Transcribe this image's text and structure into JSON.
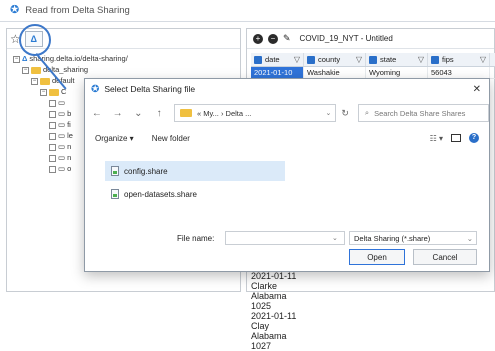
{
  "window": {
    "title": "Read from Delta Sharing"
  },
  "left": {
    "tree": [
      {
        "text": "sharing.delta.io/delta-sharing/",
        "level": 0,
        "kind": "server"
      },
      {
        "text": "delta_sharing",
        "level": 1,
        "kind": "folder"
      },
      {
        "text": "default",
        "level": 2,
        "kind": "folder"
      },
      {
        "text": "C",
        "level": 3,
        "kind": "table"
      },
      {
        "text": "",
        "level": 4,
        "kind": "item"
      },
      {
        "text": "b",
        "level": 4,
        "kind": "item"
      },
      {
        "text": "fi",
        "level": 4,
        "kind": "item"
      },
      {
        "text": "le",
        "level": 4,
        "kind": "item"
      },
      {
        "text": "n",
        "level": 4,
        "kind": "item"
      },
      {
        "text": "n",
        "level": 4,
        "kind": "item"
      },
      {
        "text": "o",
        "level": 4,
        "kind": "item"
      }
    ]
  },
  "right": {
    "title": "COVID_19_NYT - Untitled",
    "columns": [
      "date",
      "county",
      "state",
      "fips"
    ],
    "rows": [
      [
        "2021-01-10",
        "Washakie",
        "Wyoming",
        "56043"
      ]
    ],
    "bottom_rows": [
      [
        "2021-01-11",
        "Clarke",
        "Alabama",
        "1025"
      ],
      [
        "2021-01-11",
        "Clay",
        "Alabama",
        "1027"
      ]
    ]
  },
  "dialog": {
    "title": "Select Delta Sharing file",
    "address": "« My... › Delta ...",
    "search_placeholder": "Search Delta Share Shares",
    "organize_label": "Organize ▾",
    "new_folder_label": "New folder",
    "files": [
      "config.share",
      "open-datasets.share"
    ],
    "file_name_label": "File name:",
    "file_name_value": "",
    "file_type": "Delta Sharing (*.share)",
    "open_label": "Open",
    "cancel_label": "Cancel"
  }
}
